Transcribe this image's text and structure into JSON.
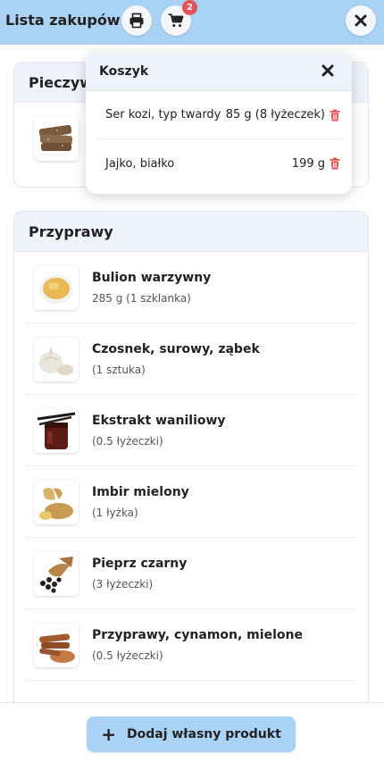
{
  "header": {
    "title": "Lista zakupów",
    "cart_count": "2",
    "print_icon": "printer-icon",
    "cart_icon": "cart-icon",
    "close_icon": "close-icon"
  },
  "sections": [
    {
      "title": "Pieczywo",
      "items": [
        {
          "icon": "bread-icon"
        }
      ]
    },
    {
      "title": "Przyprawy",
      "items": [
        {
          "name": "Bulion warzywny",
          "qty": "285 g (1 szklanka)",
          "icon": "broth-icon"
        },
        {
          "name": "Czosnek, surowy, ząbek",
          "qty": "(1 sztuka)",
          "icon": "garlic-icon"
        },
        {
          "name": "Ekstrakt waniliowy",
          "qty": "(0.5 łyżeczki)",
          "icon": "vanilla-icon"
        },
        {
          "name": "Imbir mielony",
          "qty": "(1 łyżka)",
          "icon": "ginger-icon"
        },
        {
          "name": "Pieprz czarny",
          "qty": "(3 łyżeczki)",
          "icon": "pepper-icon"
        },
        {
          "name": "Przyprawy, cynamon, mielone",
          "qty": "(0.5 łyżeczki)",
          "icon": "cinnamon-icon"
        }
      ]
    }
  ],
  "cart": {
    "title": "Koszyk",
    "items": [
      {
        "name": "Ser kozi, typ twardy",
        "qty": "85 g (8 łyżeczek)"
      },
      {
        "name": "Jajko, białko",
        "qty": "199 g"
      }
    ]
  },
  "footer": {
    "add_label": "Dodaj własny produkt"
  },
  "colors": {
    "header_bg": "#a9d2f5",
    "section_head_bg": "#eef2fa",
    "badge": "#e35353",
    "trash": "#e35353"
  }
}
